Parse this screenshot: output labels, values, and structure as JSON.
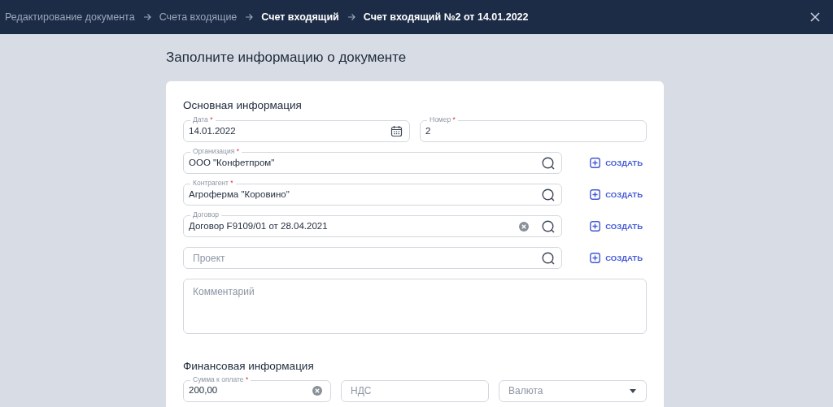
{
  "breadcrumbs": [
    {
      "label": "Редактирование документа",
      "current": false
    },
    {
      "label": "Счета входящие",
      "current": false
    },
    {
      "label": "Счет входящий",
      "current": true
    },
    {
      "label": "Счет входящий №2 от 14.01.2022",
      "current": true
    }
  ],
  "page_title": "Заполните информацию о документе",
  "sections": [
    {
      "title": "Основная информация",
      "rows": [
        {
          "fields": [
            {
              "kind": "date",
              "label": "Дата",
              "required_mark": "*",
              "value": "14.01.2022"
            },
            {
              "kind": "text",
              "label": "Номер",
              "required_mark": "*",
              "value": "2"
            }
          ]
        },
        {
          "fields": [
            {
              "kind": "lookup",
              "label": "Организация",
              "required_mark": "*",
              "value": "ООО \"Конфетпром\"",
              "clearable": false
            }
          ],
          "create": "СОЗДАТЬ"
        },
        {
          "fields": [
            {
              "kind": "lookup",
              "label": "Контрагент",
              "required_mark": "*",
              "value": "Агроферма \"Коровино\"",
              "clearable": false
            }
          ],
          "create": "СОЗДАТЬ"
        },
        {
          "fields": [
            {
              "kind": "lookup",
              "label": "Договор",
              "value": "Договор F9109/01 от 28.04.2021",
              "clearable": true
            }
          ],
          "create": "СОЗДАТЬ"
        },
        {
          "fields": [
            {
              "kind": "lookup",
              "placeholder": "Проект",
              "clearable": false
            }
          ],
          "create": "СОЗДАТЬ"
        },
        {
          "fields": [
            {
              "kind": "textarea",
              "placeholder": "Комментарий"
            }
          ]
        }
      ]
    },
    {
      "title": "Финансовая информация",
      "rows": [
        {
          "fields": [
            {
              "kind": "text",
              "label": "Сумма к оплате",
              "required_mark": "*",
              "value": "200,00",
              "clearable": true
            },
            {
              "kind": "text",
              "placeholder": "НДС"
            },
            {
              "kind": "select",
              "placeholder": "Валюта"
            }
          ]
        }
      ]
    }
  ]
}
